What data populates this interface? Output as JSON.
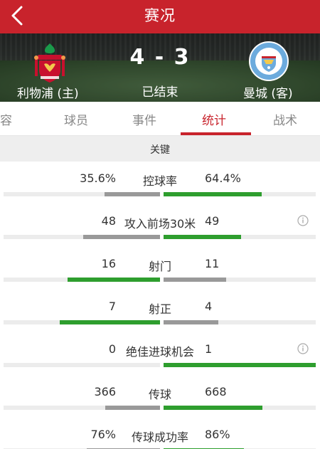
{
  "header": {
    "title": "赛况",
    "back_icon": "chevron-left-icon"
  },
  "match": {
    "home_team": "利物浦 (主)",
    "away_team": "曼城 (客)",
    "score": "4 - 3",
    "status": "已结束",
    "home_crest": {
      "icon": "liverpool-crest-icon",
      "text": "LIVERPOOL FOOTBALL CLUB",
      "color": "#c8102e"
    },
    "away_crest": {
      "icon": "manchester-city-crest-icon",
      "text": "MANCHESTER CITY",
      "color": "#6cabdd"
    }
  },
  "tabs": [
    {
      "label": "阵容",
      "active": false
    },
    {
      "label": "球员",
      "active": false
    },
    {
      "label": "事件",
      "active": false
    },
    {
      "label": "统计",
      "active": true
    },
    {
      "label": "战术",
      "active": false
    }
  ],
  "section": {
    "label": "关键"
  },
  "stats": [
    {
      "label": "控球率",
      "home": "35.6%",
      "away": "64.4%",
      "home_ratio": 0.356,
      "away_ratio": 0.644,
      "info": false
    },
    {
      "label": "攻入前场30米",
      "home": "48",
      "away": "49",
      "home_ratio": 0.49,
      "away_ratio": 0.51,
      "info": true
    },
    {
      "label": "射门",
      "home": "16",
      "away": "11",
      "home_ratio": 0.59,
      "away_ratio": 0.41,
      "info": false
    },
    {
      "label": "射正",
      "home": "7",
      "away": "4",
      "home_ratio": 0.64,
      "away_ratio": 0.36,
      "info": false
    },
    {
      "label": "绝佳进球机会",
      "home": "0",
      "away": "1",
      "home_ratio": 0.0,
      "away_ratio": 1.0,
      "info": true
    },
    {
      "label": "传球",
      "home": "366",
      "away": "668",
      "home_ratio": 0.35,
      "away_ratio": 0.65,
      "info": false
    },
    {
      "label": "传球成功率",
      "home": "76%",
      "away": "86%",
      "home_ratio": 0.47,
      "away_ratio": 0.53,
      "info": false
    }
  ],
  "colors": {
    "accent": "#c8232c",
    "bar_lead": "#2e9e2e",
    "bar_trail": "#999999",
    "track": "#ececec"
  }
}
